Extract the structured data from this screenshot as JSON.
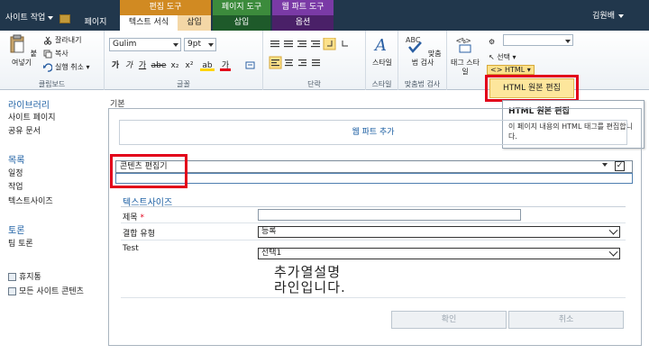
{
  "topbar": {
    "site_actions": "사이트 작업",
    "tab_page": "페이지",
    "ctx_editing_tools": "편집 도구",
    "ctx_page_tools": "페이지 도구",
    "ctx_webpart_tools": "웹 파트 도구",
    "tab_format_text": "텍스트 서식",
    "tab_insert": "삽입",
    "tab_insert2": "삽입",
    "tab_options": "옵션",
    "user": "김원배"
  },
  "ribbon": {
    "clipboard": {
      "paste": "붙여넣기",
      "cut": "잘라내기",
      "copy": "복사",
      "undo": "실행 취소",
      "label": "클립보드"
    },
    "font": {
      "family": "Gulim",
      "size": "9pt",
      "label": "글꼴",
      "bold": "가",
      "italic": "가",
      "underline": "가",
      "strike": "abe",
      "sub": "x₂",
      "sup": "x²",
      "highlight": "ab",
      "color": "가"
    },
    "paragraph": {
      "label": "단락"
    },
    "styles": {
      "styles": "스타일",
      "label": "스타일"
    },
    "spelling": {
      "spelling": "맞춤법 검사",
      "label": "맞춤법 검사"
    },
    "markup": {
      "tag": "태그 스타일",
      "select": "선택",
      "html": "HTML",
      "label": ""
    }
  },
  "htmlmenu": {
    "edit_source": "HTML 원본 편집"
  },
  "tooltip": {
    "title": "HTML 원본 편집",
    "desc": "이 페이지 내용의 HTML 태그를 편집합니다."
  },
  "leftnav": {
    "libraries": "라이브러리",
    "site_pages": "사이트 페이지",
    "shared_docs": "공유 문서",
    "lists": "목록",
    "calendar": "일정",
    "tasks": "작업",
    "textsize": "텍스트사이즈",
    "discussions": "토론",
    "team_discussion": "팀 토론",
    "recycle": "휴지통",
    "all_content": "모든 사이트 콘텐츠"
  },
  "main": {
    "zone_label": "기본",
    "add_webpart": "웹 파트 추가",
    "webpart_title": "콘텐츠 편집기",
    "list_title": "텍스트사이즈",
    "fields": {
      "title_label": "제목",
      "required_mark": "*",
      "join_label": "결합 유형",
      "join_value": "등록",
      "test_label": "Test",
      "test_value": "선택1",
      "desc_line1": "추가열설명",
      "desc_line2": "라인입니다."
    },
    "ok": "확인",
    "cancel": "취소"
  }
}
